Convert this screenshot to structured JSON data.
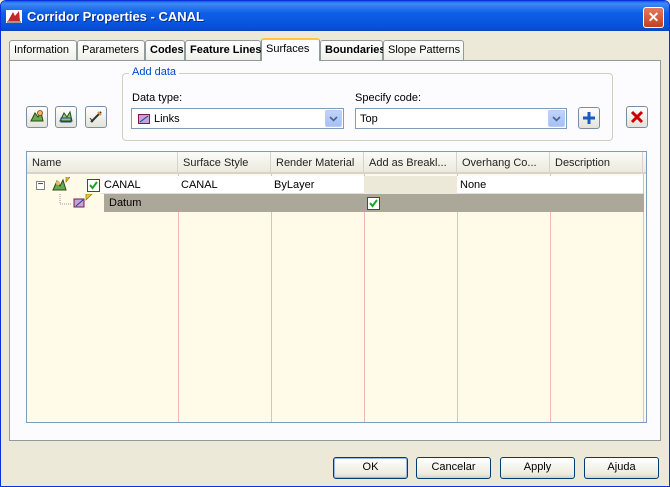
{
  "window": {
    "title": "Corridor Properties - CANAL",
    "close_label": "✕"
  },
  "tabs": [
    {
      "label": "Information",
      "bold": false,
      "active": false
    },
    {
      "label": "Parameters",
      "bold": false,
      "active": false
    },
    {
      "label": "Codes",
      "bold": true,
      "active": false
    },
    {
      "label": "Feature Lines",
      "bold": true,
      "active": false
    },
    {
      "label": "Surfaces",
      "bold": false,
      "active": true
    },
    {
      "label": "Boundaries",
      "bold": true,
      "active": false
    },
    {
      "label": "Slope Patterns",
      "bold": false,
      "active": false
    }
  ],
  "toolbar": {
    "icons": [
      "create-surface-icon",
      "add-surface-item-icon",
      "edit-surface-name-icon"
    ],
    "add_icon": "plus-icon",
    "delete_icon": "red-x-icon"
  },
  "add_data": {
    "legend": "Add data",
    "data_type_label": "Data type:",
    "data_type_value": "Links",
    "specify_code_label": "Specify code:",
    "specify_code_value": "Top"
  },
  "grid": {
    "columns": [
      "Name",
      "Surface Style",
      "Render Material",
      "Add as Breakl...",
      "Overhang Co...",
      "Description"
    ],
    "rows": [
      {
        "name": "CANAL",
        "surface_style": "CANAL",
        "render_material": "ByLayer",
        "add_as_breakline": "",
        "overhang": "None",
        "description": "",
        "checked": true,
        "expanded": true
      },
      {
        "name": "Datum",
        "surface_style": "",
        "render_material": "",
        "add_as_breakline": "checked",
        "overhang": "",
        "description": ""
      }
    ],
    "expander": "−"
  },
  "buttons": {
    "ok": "OK",
    "cancel": "Cancelar",
    "apply": "Apply",
    "help": "Ajuda"
  },
  "colors": {
    "titlebar": "#0552d9",
    "tab_highlight": "#ffc83c",
    "grid_bg": "#fffbe8",
    "selected_row": "#aca899"
  }
}
